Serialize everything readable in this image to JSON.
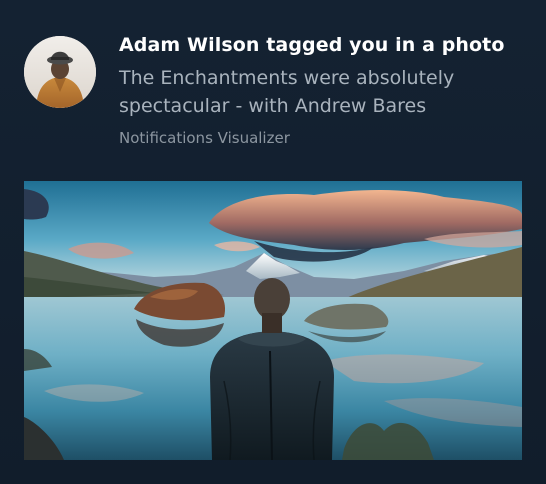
{
  "notification": {
    "title": "Adam Wilson tagged you in a photo",
    "body": "The Enchantments were absolutely spectacular - with Andrew Bares",
    "attribution": "Notifications Visualizer"
  },
  "images": {
    "avatar": "person-avatar",
    "hero": "mountain-lake-photo"
  }
}
